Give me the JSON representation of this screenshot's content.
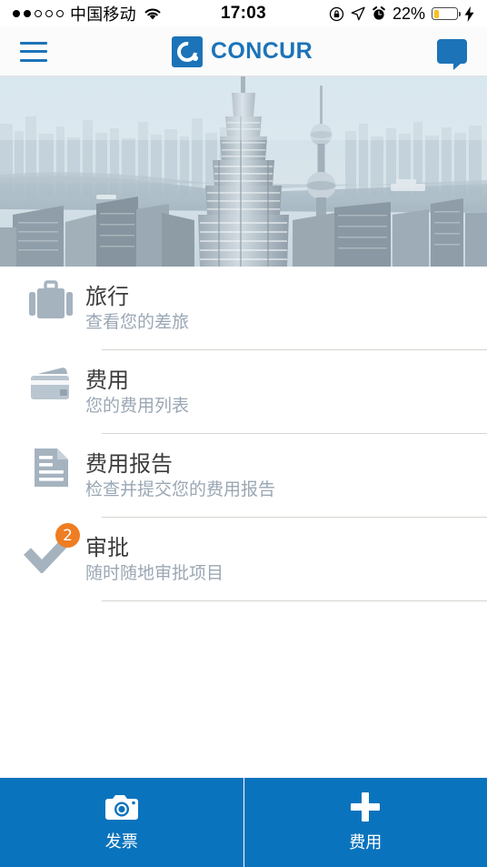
{
  "status_bar": {
    "signal_dots_filled": 2,
    "signal_dots_total": 5,
    "carrier": "中国移动",
    "wifi_icon": "wifi-icon",
    "time": "17:03",
    "rotation_lock_icon": "rotation-lock-icon",
    "location_icon": "location-arrow-icon",
    "alarm_icon": "alarm-clock-icon",
    "battery_percent": "22%",
    "battery_level": 22,
    "battery_color": "#f9c023",
    "charging_icon": "lightning-bolt-icon"
  },
  "nav_bar": {
    "menu_icon": "hamburger-menu-icon",
    "brand_name": "CONCUR",
    "brand_mark_icon": "concur-logo-icon",
    "chat_icon": "chat-bubble-icon",
    "brand_color": "#1c73b8"
  },
  "hero": {
    "image_name": "shanghai-skyline-photo",
    "alt": "Shanghai skyline with Jin Mao Tower and Oriental Pearl Tower"
  },
  "menu": {
    "items": [
      {
        "icon": "suitcase-icon",
        "title": "旅行",
        "subtitle": "查看您的差旅",
        "badge": null
      },
      {
        "icon": "credit-cards-icon",
        "title": "费用",
        "subtitle": "您的费用列表",
        "badge": null
      },
      {
        "icon": "document-icon",
        "title": "费用报告",
        "subtitle": "检查并提交您的费用报告",
        "badge": null
      },
      {
        "icon": "checkmark-icon",
        "title": "审批",
        "subtitle": "随时随地审批项目",
        "badge": "2"
      }
    ]
  },
  "bottom_bar": {
    "background_color": "#0a73bd",
    "items": [
      {
        "icon": "camera-icon",
        "label": "发票"
      },
      {
        "icon": "plus-icon",
        "label": "费用"
      }
    ]
  }
}
